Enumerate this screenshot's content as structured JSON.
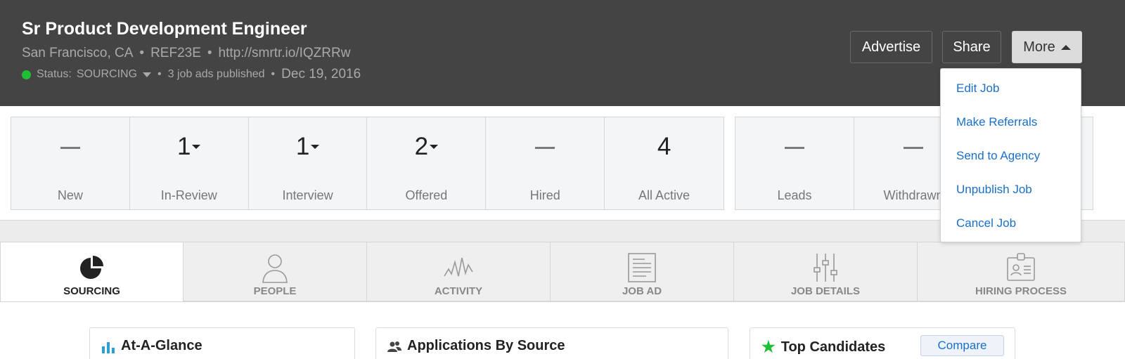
{
  "header": {
    "job_title": "Sr Product Development Engineer",
    "location": "San Francisco, CA",
    "ref": "REF23E",
    "link": "http://smrtr.io/IQZRRw",
    "bullet": "•",
    "status_label": "Status:",
    "status_value": "SOURCING",
    "job_ads": "3 job ads published",
    "date": "Dec 19, 2016",
    "status_color": "#1fbf35"
  },
  "buttons": {
    "advertise": "Advertise",
    "share": "Share",
    "more": "More"
  },
  "more_menu": {
    "items": [
      "Edit Job",
      "Make Referrals",
      "Send to Agency",
      "Unpublish Job",
      "Cancel Job"
    ]
  },
  "stats": {
    "pipeline": [
      {
        "value": "—",
        "label": "New"
      },
      {
        "value": "1",
        "label": "In-Review"
      },
      {
        "value": "1",
        "label": "Interview"
      },
      {
        "value": "2",
        "label": "Offered"
      },
      {
        "value": "—",
        "label": "Hired"
      },
      {
        "value": "4",
        "label": "All Active"
      }
    ],
    "other": [
      {
        "value": "—",
        "label": "Leads"
      },
      {
        "value": "—",
        "label": "Withdrawn"
      },
      {
        "value": "",
        "label": ""
      }
    ]
  },
  "tabs": [
    {
      "label": "SOURCING",
      "icon": "pie-chart-icon"
    },
    {
      "label": "PEOPLE",
      "icon": "person-icon"
    },
    {
      "label": "ACTIVITY",
      "icon": "activity-wave-icon"
    },
    {
      "label": "JOB AD",
      "icon": "document-icon"
    },
    {
      "label": "JOB DETAILS",
      "icon": "sliders-icon"
    },
    {
      "label": "HIRING PROCESS",
      "icon": "id-badge-icon"
    }
  ],
  "cards": {
    "at_a_glance": "At-A-Glance",
    "applications_by_source": "Applications By Source",
    "top_candidates": "Top Candidates",
    "compare": "Compare"
  },
  "colors": {
    "header_bg": "#444444",
    "link_blue": "#1a6fc9",
    "star_green": "#1fbf35"
  }
}
